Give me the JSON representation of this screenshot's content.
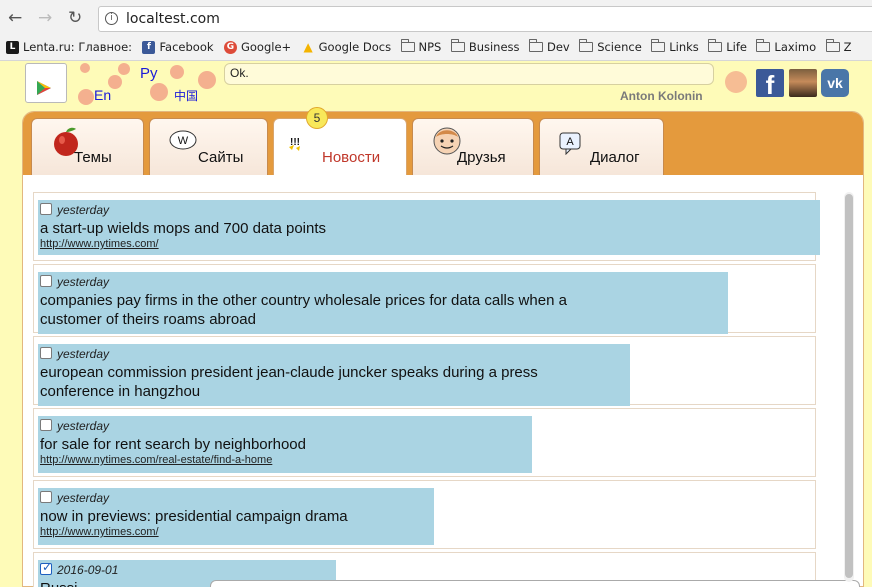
{
  "browser": {
    "url": "localtest.com",
    "bookmarks": [
      {
        "label": "Lenta.ru: Главное:",
        "icon": "lenta-icon",
        "color": "#1a1a1a",
        "glyph": "L"
      },
      {
        "label": "Facebook",
        "icon": "facebook-icon",
        "color": "#3b5998",
        "glyph": "f"
      },
      {
        "label": "Google+",
        "icon": "google-plus-icon",
        "color": "#dd4b39",
        "glyph": "G"
      },
      {
        "label": "Google Docs",
        "icon": "google-drive-icon",
        "color": "#f4b400",
        "glyph": "▲"
      },
      {
        "label": "NPS",
        "icon": "folder-icon"
      },
      {
        "label": "Business",
        "icon": "folder-icon"
      },
      {
        "label": "Dev",
        "icon": "folder-icon"
      },
      {
        "label": "Science",
        "icon": "folder-icon"
      },
      {
        "label": "Links",
        "icon": "folder-icon"
      },
      {
        "label": "Life",
        "icon": "folder-icon"
      },
      {
        "label": "Laximo",
        "icon": "folder-icon"
      },
      {
        "label": "Z",
        "icon": "folder-icon"
      }
    ]
  },
  "header": {
    "languages": [
      "En",
      "Ру",
      "中国"
    ],
    "status": "Ok.",
    "user_name": "Anton Kolonin"
  },
  "tabs": [
    {
      "label": "Темы",
      "icon": "apple-icon"
    },
    {
      "label": "Сайты",
      "icon": "www-bubble-icon"
    },
    {
      "label": "Новости",
      "icon": "exclamation-icon",
      "badge": "5",
      "active": true
    },
    {
      "label": "Друзья",
      "icon": "smiley-icon"
    },
    {
      "label": "Диалог",
      "icon": "a-bubble-icon"
    }
  ],
  "news": [
    {
      "date": "yesterday",
      "checked": false,
      "title": "a start-up wields mops and 700 data points",
      "link": "http://www.nytimes.com/"
    },
    {
      "date": "yesterday",
      "checked": false,
      "title_lines": [
        "companies pay firms in the other country wholesale prices for data calls when a",
        "customer of theirs roams abroad"
      ],
      "link": ""
    },
    {
      "date": "yesterday",
      "checked": false,
      "title_lines": [
        "european commission president jean-claude juncker speaks during a press",
        "conference in hangzhou"
      ],
      "link": ""
    },
    {
      "date": "yesterday",
      "checked": false,
      "title": "for sale for rent search by neighborhood",
      "link": "http://www.nytimes.com/real-estate/find-a-home"
    },
    {
      "date": "yesterday",
      "checked": false,
      "title": "now in previews: presidential campaign drama",
      "link": "http://www.nytimes.com/"
    },
    {
      "date": "2016-09-01",
      "checked": true,
      "title": "Russi",
      "link": ""
    }
  ],
  "colors": {
    "page_bg": "#fefbb8",
    "tabbar": "#e49a3d",
    "highlight": "#aad4e3",
    "active_tab_text": "#c0382b"
  }
}
